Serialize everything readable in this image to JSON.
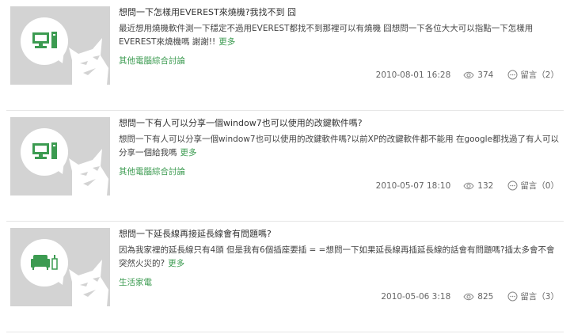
{
  "posts": [
    {
      "title": "想問一下怎樣用EVEREST來燒機?我找不到 囧",
      "excerpt": "最近想用燒機軟件測一下穩定不過用EVEREST都找不到那裡可以有燒機 囧想問一下各位大大可以指點一下怎樣用EVEREST來燒機嗎 謝謝!!",
      "more_label": "更多",
      "category": "其他電腦綜合討論",
      "date": "2010-08-01 16:28",
      "views": "374",
      "comments_label": "留言（2）",
      "thumb_icon": "computer-icon"
    },
    {
      "title": "想問一下有人可以分享一個window7也可以使用的改鍵軟件嗎?",
      "excerpt": "想問一下有人可以分享一個window7也可以使用的改鍵軟件嗎?以前XP的改鍵軟件都不能用 在google都找過了有人可以分享一個給我嗎",
      "more_label": "更多",
      "category": "其他電腦綜合討論",
      "date": "2010-05-07 18:10",
      "views": "132",
      "comments_label": "留言（0）",
      "thumb_icon": "computer-icon"
    },
    {
      "title": "想問一下延長線再接延長線會有問題嗎?",
      "excerpt": "因為我家裡的延長線只有4頭 但是我有6個插座要插 = =想問一下如果延長線再插延長線的話會有問題嗎?插太多會不會突然火災的?",
      "more_label": "更多",
      "category": "生活家電",
      "date": "2010-05-06 3:18",
      "views": "825",
      "comments_label": "留言（3）",
      "thumb_icon": "sofa-icon"
    }
  ],
  "colors": {
    "accent": "#3c9b51",
    "thumb_bg": "#d3d3d3",
    "text": "#333333",
    "meta": "#666666"
  }
}
